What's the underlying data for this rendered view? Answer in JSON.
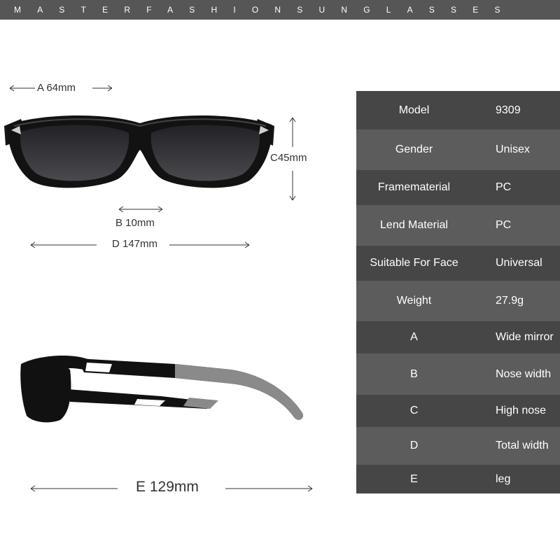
{
  "header": {
    "brand_text": "MASTERFASHIONSUNGLASSES"
  },
  "dimensions": {
    "a": "A 64mm",
    "b": "B 10mm",
    "c": "C45mm",
    "d": "D 147mm",
    "e": "E 129mm"
  },
  "specs": [
    {
      "label": "Model",
      "value": "9309"
    },
    {
      "label": "Gender",
      "value": "Unisex"
    },
    {
      "label": "Framematerial",
      "value": "PC"
    },
    {
      "label": "Lend Material",
      "value": "PC"
    },
    {
      "label": "Suitable For Face",
      "value": "Universal"
    },
    {
      "label": "Weight",
      "value": "27.9g"
    },
    {
      "label": "A",
      "value": "Wide mirror"
    },
    {
      "label": "B",
      "value": "Nose width"
    },
    {
      "label": "C",
      "value": "High nose"
    },
    {
      "label": "D",
      "value": "Total width"
    },
    {
      "label": "E",
      "value": "leg"
    }
  ],
  "colors": {
    "header_bar": "#565656",
    "table_dark": "#464646",
    "table_light": "#5c5c5c",
    "frame": "#111111",
    "lens": "#3a3a3c",
    "temple_accent": "#8a8a8a"
  }
}
